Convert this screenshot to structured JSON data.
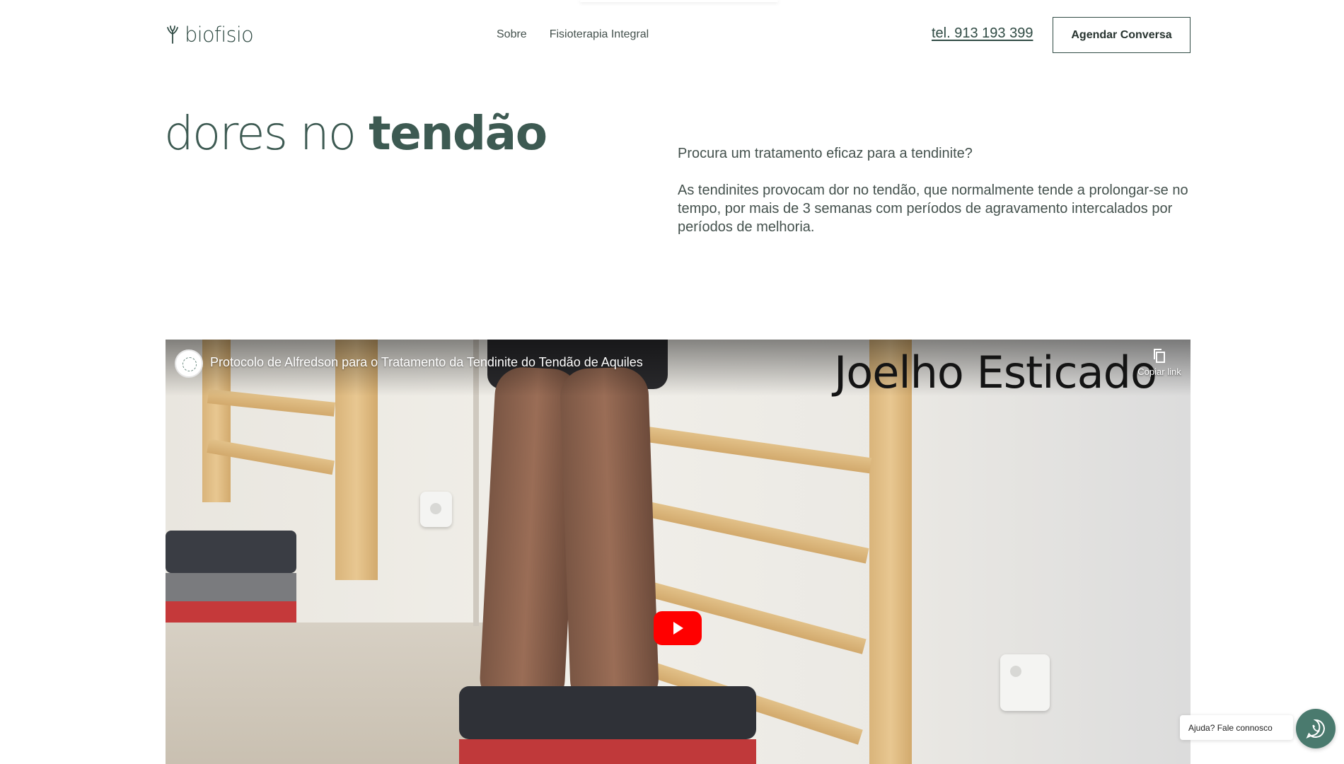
{
  "header": {
    "logo_text": "biofisio",
    "nav": [
      {
        "label": "Sobre"
      },
      {
        "label": "Fisioterapia Integral"
      }
    ],
    "phone": "tel. 913 193 399",
    "cta_label": "Agendar Conversa"
  },
  "hero": {
    "title_light": "dores no ",
    "title_bold": "tendão",
    "intro_question": "Procura um tratamento eficaz para a tendinite?",
    "intro_body": "As tendinites provocam dor no tendão, que normalmente tende a prolongar-se no tempo, por mais de 3 semanas com períodos de agravamento intercalados por períodos de melhoria."
  },
  "video": {
    "title": "Protocolo de Alfredson para o Tratamento da Tendinite do Tendão de Aquiles",
    "overlay_caption": "Joelho Esticado",
    "copy_link_label": "Copiar link",
    "play_icon": "youtube-play-icon"
  },
  "help": {
    "bubble_text": "Ajuda? Fale connosco",
    "icon": "whatsapp-icon"
  },
  "colors": {
    "brand": "#2f4a43",
    "heading": "#3d5a52",
    "youtube_red": "#ff0000",
    "whatsapp_bg": "#4a7a6e"
  }
}
